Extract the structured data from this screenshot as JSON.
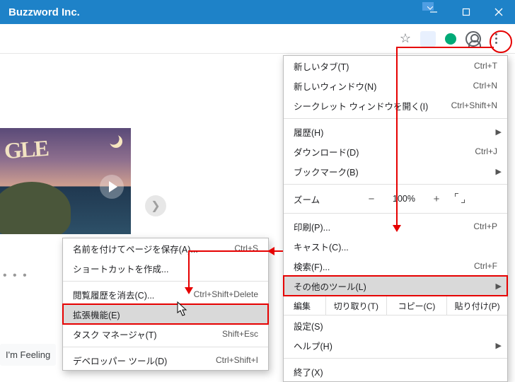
{
  "window": {
    "title": "Buzzword Inc."
  },
  "doodle": {
    "letters": "GLE"
  },
  "search": {
    "feeling": "I'm Feeling"
  },
  "main_menu": {
    "new_tab": {
      "label": "新しいタブ(T)",
      "shortcut": "Ctrl+T"
    },
    "new_window": {
      "label": "新しいウィンドウ(N)",
      "shortcut": "Ctrl+N"
    },
    "incognito": {
      "label": "シークレット ウィンドウを開く(I)",
      "shortcut": "Ctrl+Shift+N"
    },
    "history": {
      "label": "履歴(H)"
    },
    "downloads": {
      "label": "ダウンロード(D)",
      "shortcut": "Ctrl+J"
    },
    "bookmarks": {
      "label": "ブックマーク(B)"
    },
    "zoom": {
      "label": "ズーム",
      "minus": "−",
      "value": "100%",
      "plus": "+",
      "fullscreen": "⛶"
    },
    "print": {
      "label": "印刷(P)...",
      "shortcut": "Ctrl+P"
    },
    "cast": {
      "label": "キャスト(C)..."
    },
    "find": {
      "label": "検索(F)...",
      "shortcut": "Ctrl+F"
    },
    "more_tools": {
      "label": "その他のツール(L)"
    },
    "edit": {
      "label": "編集",
      "cut": "切り取り(T)",
      "copy": "コピー(C)",
      "paste": "貼り付け(P)"
    },
    "settings": {
      "label": "設定(S)"
    },
    "help": {
      "label": "ヘルプ(H)"
    },
    "exit": {
      "label": "終了(X)"
    }
  },
  "sub_menu": {
    "save_as": {
      "label": "名前を付けてページを保存(A)...",
      "shortcut": "Ctrl+S"
    },
    "create_shortcut": {
      "label": "ショートカットを作成..."
    },
    "clear_browsing": {
      "label": "閲覧履歴を消去(C)...",
      "shortcut": "Ctrl+Shift+Delete"
    },
    "extensions": {
      "label": "拡張機能(E)"
    },
    "task_manager": {
      "label": "タスク マネージャ(T)",
      "shortcut": "Shift+Esc"
    },
    "dev_tools": {
      "label": "デベロッパー ツール(D)",
      "shortcut": "Ctrl+Shift+I"
    }
  }
}
